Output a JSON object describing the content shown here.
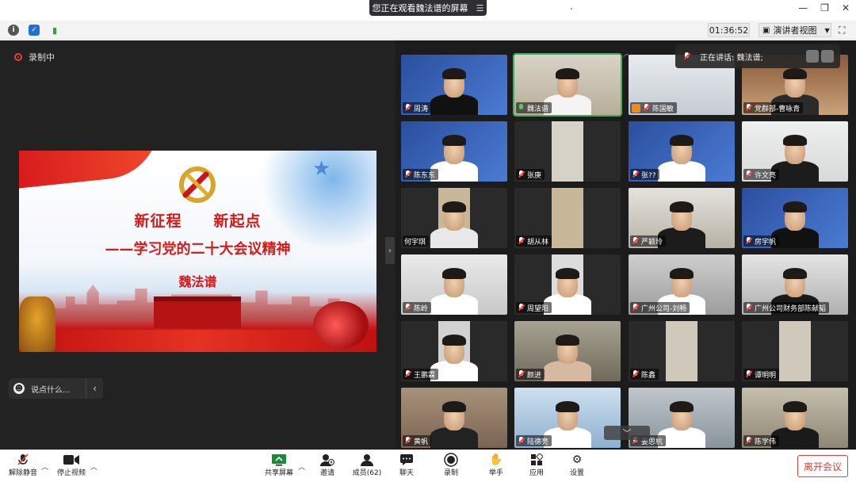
{
  "share_banner": {
    "text": "您正在观看魏法谱的屏幕"
  },
  "toolbar": {
    "timer": "01:36:52",
    "presenter_view": "演讲者视图"
  },
  "recording": {
    "label": "录制中"
  },
  "slide": {
    "line1": "新征程　　新起点",
    "line2": "——学习党的二十大会议精神",
    "author": "魏法谱"
  },
  "chat": {
    "placeholder": "说点什么..."
  },
  "speaking": {
    "text": "正在讲话: 魏法谱;"
  },
  "participants": [
    {
      "name": "周涛",
      "mic": "off"
    },
    {
      "name": "魏法谱",
      "mic": "on"
    },
    {
      "name": "陈国敏",
      "mic": "off"
    },
    {
      "name": "党群部-曹咏青",
      "mic": "off"
    },
    {
      "name": "陈东东",
      "mic": "off"
    },
    {
      "name": "张庚",
      "mic": "off"
    },
    {
      "name": "张??",
      "mic": "off"
    },
    {
      "name": "许文亮",
      "mic": "off"
    },
    {
      "name": "何宇琪",
      "mic": "none"
    },
    {
      "name": "胡从林",
      "mic": "off"
    },
    {
      "name": "严颖玲",
      "mic": "off"
    },
    {
      "name": "房宇帆",
      "mic": "off"
    },
    {
      "name": "陈岭",
      "mic": "off"
    },
    {
      "name": "周望阳",
      "mic": "off"
    },
    {
      "name": "广州公司-刘畅",
      "mic": "off"
    },
    {
      "name": "广州公司财务部陈献韬",
      "mic": "off"
    },
    {
      "name": "王鹏霖",
      "mic": "off"
    },
    {
      "name": "颜进",
      "mic": "off"
    },
    {
      "name": "陈鑫",
      "mic": "off"
    },
    {
      "name": "谭明明",
      "mic": "off"
    },
    {
      "name": "黄帆",
      "mic": "off"
    },
    {
      "name": "陆德亮",
      "mic": "off"
    },
    {
      "name": "姜思杭",
      "mic": "off"
    },
    {
      "name": "陈学伟",
      "mic": "off"
    }
  ],
  "bottom": {
    "unmute": "解除静音",
    "stop_video": "停止视频",
    "share_screen": "共享屏幕",
    "invite": "邀请",
    "members": "成员(62)",
    "chat": "聊天",
    "record": "录制",
    "raise_hand": "举手",
    "apps": "应用",
    "settings": "设置",
    "leave": "离开会议"
  },
  "colors": {
    "accent_red": "#e0413a",
    "active_green": "#3fae5a",
    "slide_red": "#d51a1a"
  }
}
